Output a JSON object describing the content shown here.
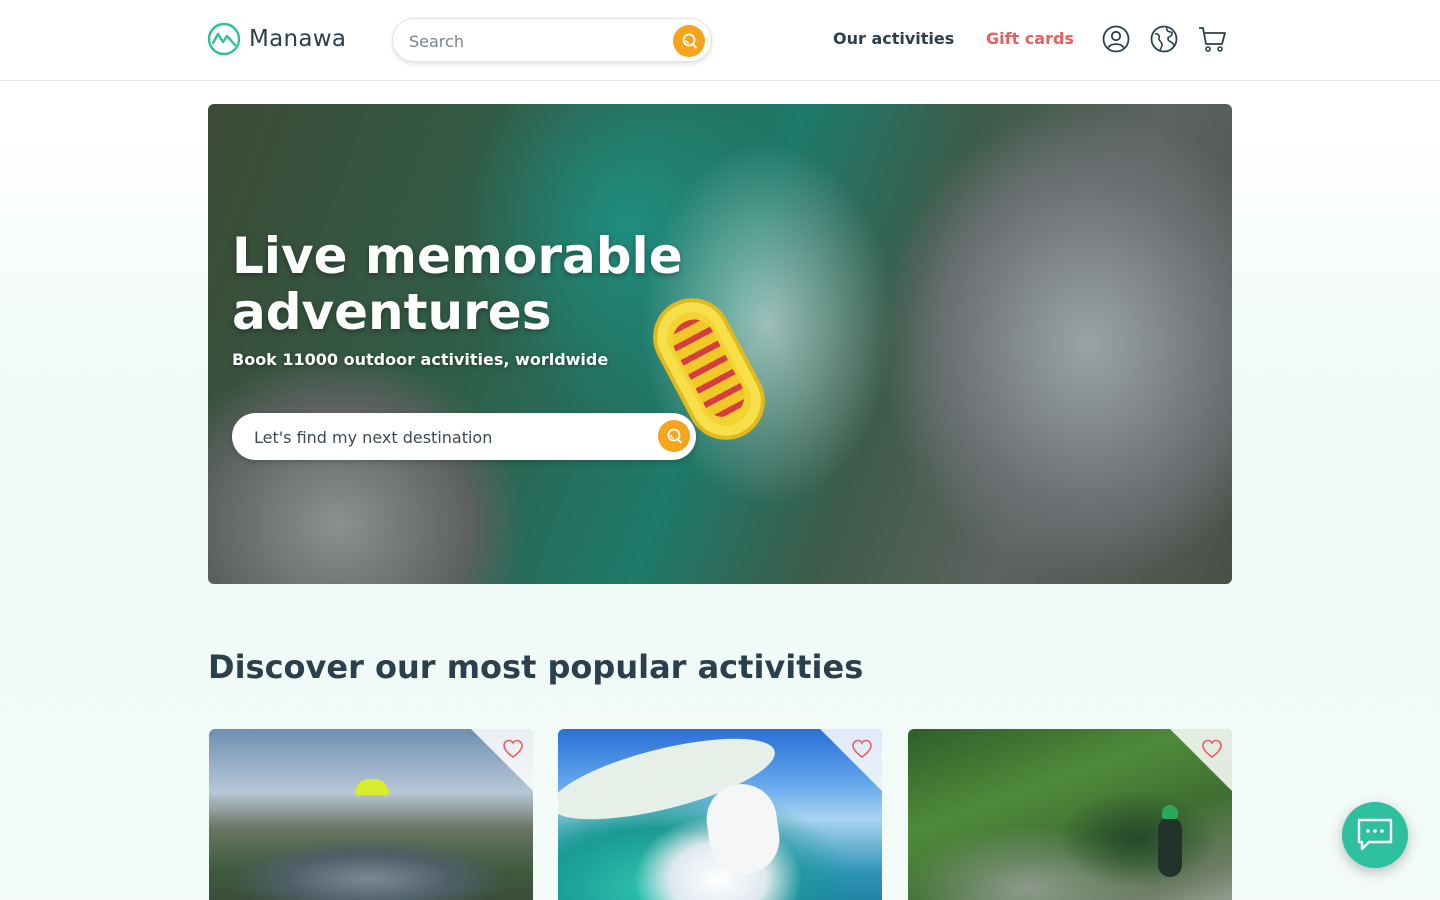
{
  "header": {
    "logo_text": "Manawa",
    "search_placeholder": "Search",
    "nav": {
      "activities": "Our activities",
      "gift_cards": "Gift cards"
    },
    "icons": [
      "user-icon",
      "globe-icon",
      "cart-icon"
    ]
  },
  "hero": {
    "title": "Live memorable adventures",
    "subtitle": "Book 11000 outdoor activities, worldwide",
    "search_placeholder": "Let's find my next destination"
  },
  "popular": {
    "title": "Discover our most popular activities",
    "cards": [
      {
        "image": "paragliding over lake and mountains",
        "icon": "heart-icon"
      },
      {
        "image": "seaplane over turquoise lagoon",
        "icon": "heart-icon"
      },
      {
        "image": "canyoning in green forest",
        "icon": "heart-icon"
      }
    ]
  },
  "colors": {
    "accent": "#f5a51c",
    "brand": "#2dbf9e",
    "gift": "#e8605d",
    "text": "#2b3f4c"
  }
}
